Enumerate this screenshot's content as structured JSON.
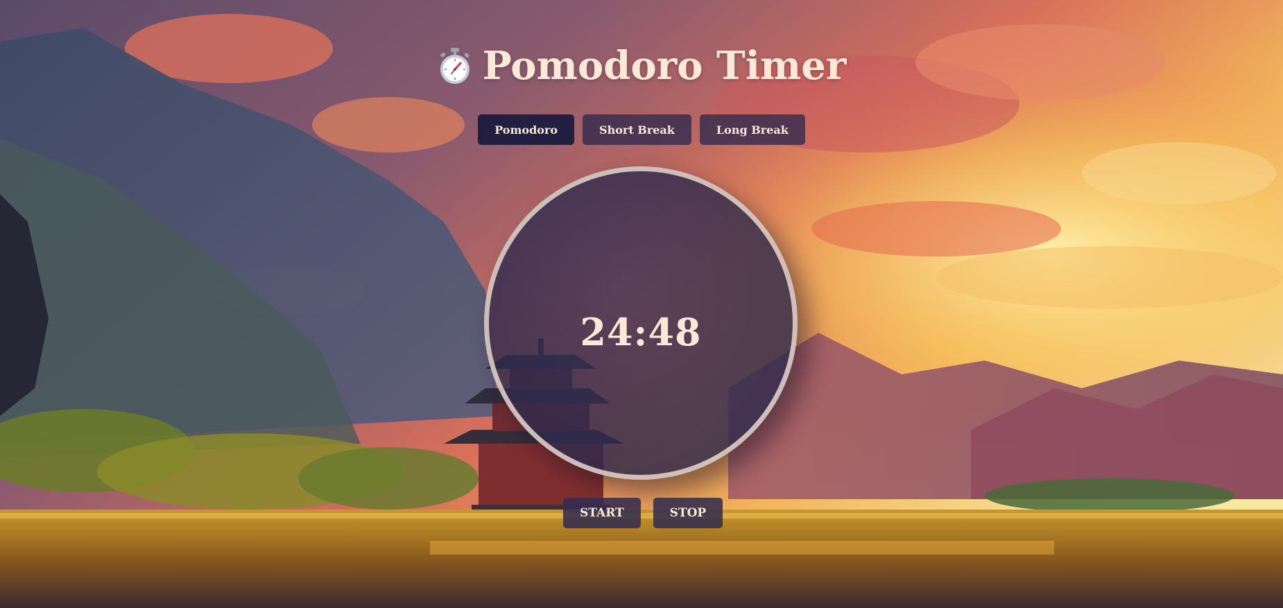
{
  "app": {
    "title": "Pomodoro Timer",
    "title_icon": "stopwatch-icon"
  },
  "modes": [
    {
      "label": "Pomodoro",
      "active": true
    },
    {
      "label": "Short Break",
      "active": false
    },
    {
      "label": "Long Break",
      "active": false
    }
  ],
  "timer": {
    "display": "24:48"
  },
  "controls": {
    "start_label": "START",
    "stop_label": "STOP"
  },
  "colors": {
    "text": "#fbe9d8",
    "button_bg": "#342c4e",
    "active_button_bg": "#181a3e",
    "ring": "#e6d7cd"
  }
}
